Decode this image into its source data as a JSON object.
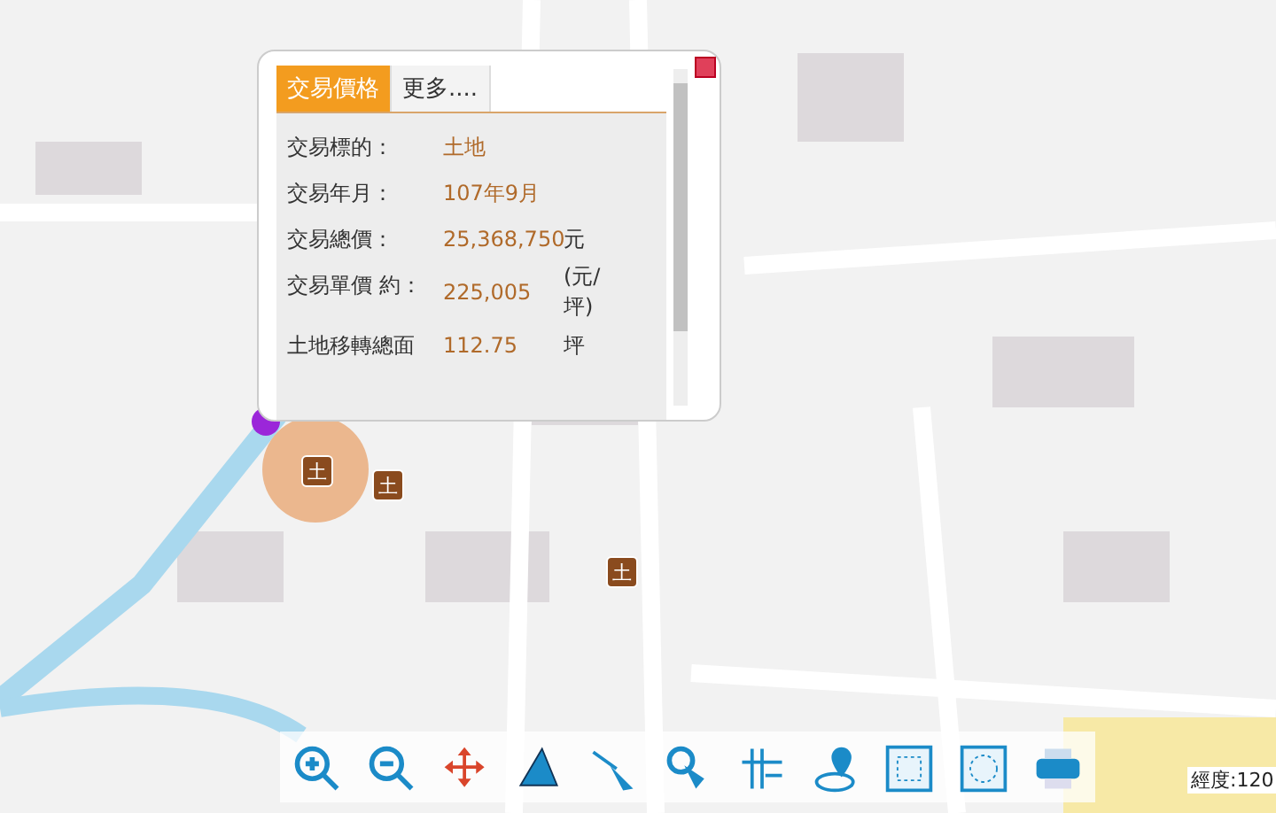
{
  "popup": {
    "tabs": [
      {
        "label": "交易價格",
        "selected": true
      },
      {
        "label": "更多....",
        "selected": false
      }
    ],
    "rows": [
      {
        "label": "交易標的：",
        "value": "土地"
      },
      {
        "label": "交易年月：",
        "value": "107年9月"
      },
      {
        "label": "交易總價：",
        "value": "25,368,750",
        "unit": "元"
      },
      {
        "label": "交易單價 約：",
        "value": "225,005",
        "unit": "(元/坪)"
      },
      {
        "label": "土地移轉總面",
        "value": "112.75",
        "unit": "坪"
      }
    ]
  },
  "markers": [
    {
      "label": "土"
    },
    {
      "label": "土"
    },
    {
      "label": "土"
    }
  ],
  "toolbar": [
    {
      "kind": "zoom-in"
    },
    {
      "kind": "zoom-out"
    },
    {
      "kind": "pan"
    },
    {
      "kind": "area"
    },
    {
      "kind": "distance"
    },
    {
      "kind": "select"
    },
    {
      "kind": "grid"
    },
    {
      "kind": "locate"
    },
    {
      "kind": "rect"
    },
    {
      "kind": "circle"
    },
    {
      "kind": "print"
    }
  ],
  "coordinate": "經度:120"
}
